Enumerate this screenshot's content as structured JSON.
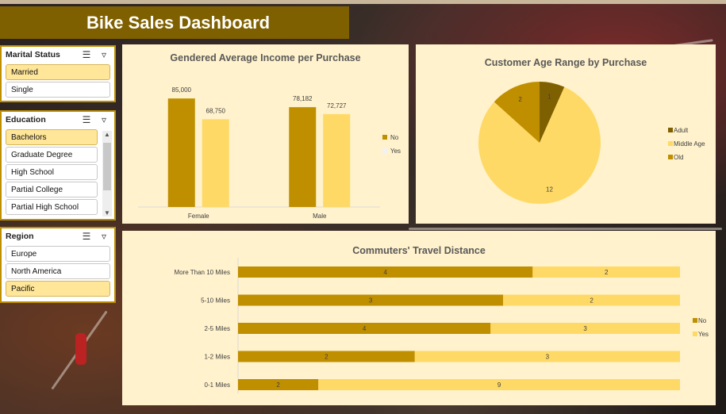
{
  "dashboard": {
    "title": "Bike Sales Dashboard"
  },
  "slicers": {
    "marital_status": {
      "title": "Marital Status",
      "items": [
        {
          "label": "Married",
          "selected": true
        },
        {
          "label": "Single",
          "selected": false
        }
      ]
    },
    "education": {
      "title": "Education",
      "items": [
        {
          "label": "Bachelors",
          "selected": true
        },
        {
          "label": "Graduate Degree",
          "selected": false
        },
        {
          "label": "High School",
          "selected": false
        },
        {
          "label": "Partial College",
          "selected": false
        },
        {
          "label": "Partial High School",
          "selected": false
        }
      ]
    },
    "region": {
      "title": "Region",
      "items": [
        {
          "label": "Europe",
          "selected": false
        },
        {
          "label": "North America",
          "selected": false
        },
        {
          "label": "Pacific",
          "selected": true
        }
      ]
    },
    "icons": {
      "multi_select": "multi-select-icon",
      "clear_filter": "clear-filter-icon"
    }
  },
  "colors": {
    "dark": "#bf8f00",
    "light": "#ffd966",
    "darkest": "#7f6000",
    "legend_yes": "#f2f2f2",
    "panel_bg": "#fff2cc"
  },
  "chart_data": [
    {
      "type": "bar",
      "title": "Gendered Average Income per Purchase",
      "categories": [
        "Female",
        "Male"
      ],
      "series": [
        {
          "name": "No",
          "values": [
            85000,
            78182
          ]
        },
        {
          "name": "Yes",
          "values": [
            68750,
            72727
          ]
        }
      ],
      "data_labels": [
        [
          "85,000",
          "78,182"
        ],
        [
          "68,750",
          "72,727"
        ]
      ],
      "ylim": [
        0,
        100000
      ],
      "legend": "right",
      "grid": false
    },
    {
      "type": "pie",
      "title": "Customer Age Range by Purchase",
      "slices": [
        {
          "name": "Adult",
          "value": 1
        },
        {
          "name": "Middle Age",
          "value": 12
        },
        {
          "name": "Old",
          "value": 2
        }
      ],
      "legend": "right"
    },
    {
      "type": "bar",
      "orientation": "horizontal",
      "stacked": true,
      "title": "Commuters' Travel Distance",
      "categories": [
        "More Than 10 Miles",
        "5-10 Miles",
        "2-5 Miles",
        "1-2 Miles",
        "0-1 Miles"
      ],
      "series": [
        {
          "name": "No",
          "values": [
            4,
            3,
            4,
            2,
            2
          ]
        },
        {
          "name": "Yes",
          "values": [
            2,
            2,
            3,
            3,
            9
          ]
        }
      ],
      "legend": "right",
      "grid": false
    }
  ]
}
